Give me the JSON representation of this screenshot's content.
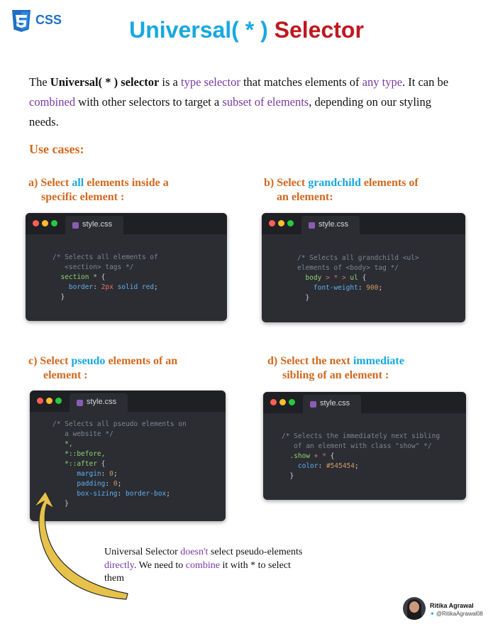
{
  "logo": {
    "text": "CSS"
  },
  "title": {
    "part1": "Universal( * )",
    "part2": "Selector"
  },
  "intro": {
    "t1": "The ",
    "t2": "Universal( * ) selector",
    "t3": "  is a ",
    "t4": "type selector",
    "t5": " that matches elements of ",
    "t6": "any type",
    "t7": ". It can be ",
    "t8": "combined",
    "t9": " with other selectors to target a ",
    "t10": "subset of elements",
    "t11": ", depending on our styling needs."
  },
  "use_cases_heading": "Use cases:",
  "cases": {
    "a": {
      "prefix": "a) Select ",
      "hl": "all",
      "rest": " elements inside a",
      "line2": "specific element :"
    },
    "b": {
      "prefix": "b) Select ",
      "hl": "grandchild",
      "rest": " elements of",
      "line2": "an element:"
    },
    "c": {
      "prefix": "c)  Select ",
      "hl": "pseudo",
      "rest": " elements of an",
      "line2": "element :"
    },
    "d": {
      "prefix": "d)  Select the next ",
      "hl": "immediate",
      "rest": "",
      "line2": "sibling of an element :"
    }
  },
  "tab_label": "style.css",
  "code": {
    "a": {
      "c1": "/* Selects all elements of",
      "c2": "   <section> tags */",
      "sel1": "section",
      "sel2": " * ",
      "brace": "{",
      "prop": "border",
      "val_num": "2px",
      "val_rest": " solid red",
      "close": "}"
    },
    "b": {
      "c1": "/* Selects all grandchild <ul>",
      "c2": "elements of <body> tag */",
      "sel1": "body",
      "sel2": " > * > ",
      "sel3": "ul",
      "brace": " {",
      "prop": "font-weight",
      "val": "900",
      "close": "}"
    },
    "c": {
      "c1": "/* Selects all pseudo elements on",
      "c2": "   a website */",
      "s1": "*,",
      "s2": "*::before,",
      "s3": "*::after",
      "brace": " {",
      "p1": "margin",
      "v1": "0",
      "p2": "padding",
      "v2": "0",
      "p3": "box-sizing",
      "v3": "border-box",
      "close": "}"
    },
    "d": {
      "c1": "/* Selects the immediately next sibling",
      "c2": "   of an element with class \"show\" */",
      "sel1": ".show",
      "sel2": " + * ",
      "brace": "{",
      "prop": "color",
      "val": "#545454",
      "close": "}"
    }
  },
  "note": {
    "t1": "Universal Selector ",
    "t2": "doesn't",
    "t3": " select pseudo-elements ",
    "t4": "directly",
    "t5": ". We need to ",
    "t6": "combine",
    "t7": " it with * to select them"
  },
  "author": {
    "name": "Ritika Agrawal",
    "handle": "@RitikaAgrawal08"
  },
  "colors": {
    "title_blue": "#17a8e0",
    "title_red": "#c0171f",
    "accent_orange": "#d2691e",
    "accent_purple": "#7a3aa6",
    "editor_bg": "#2b2d33"
  }
}
